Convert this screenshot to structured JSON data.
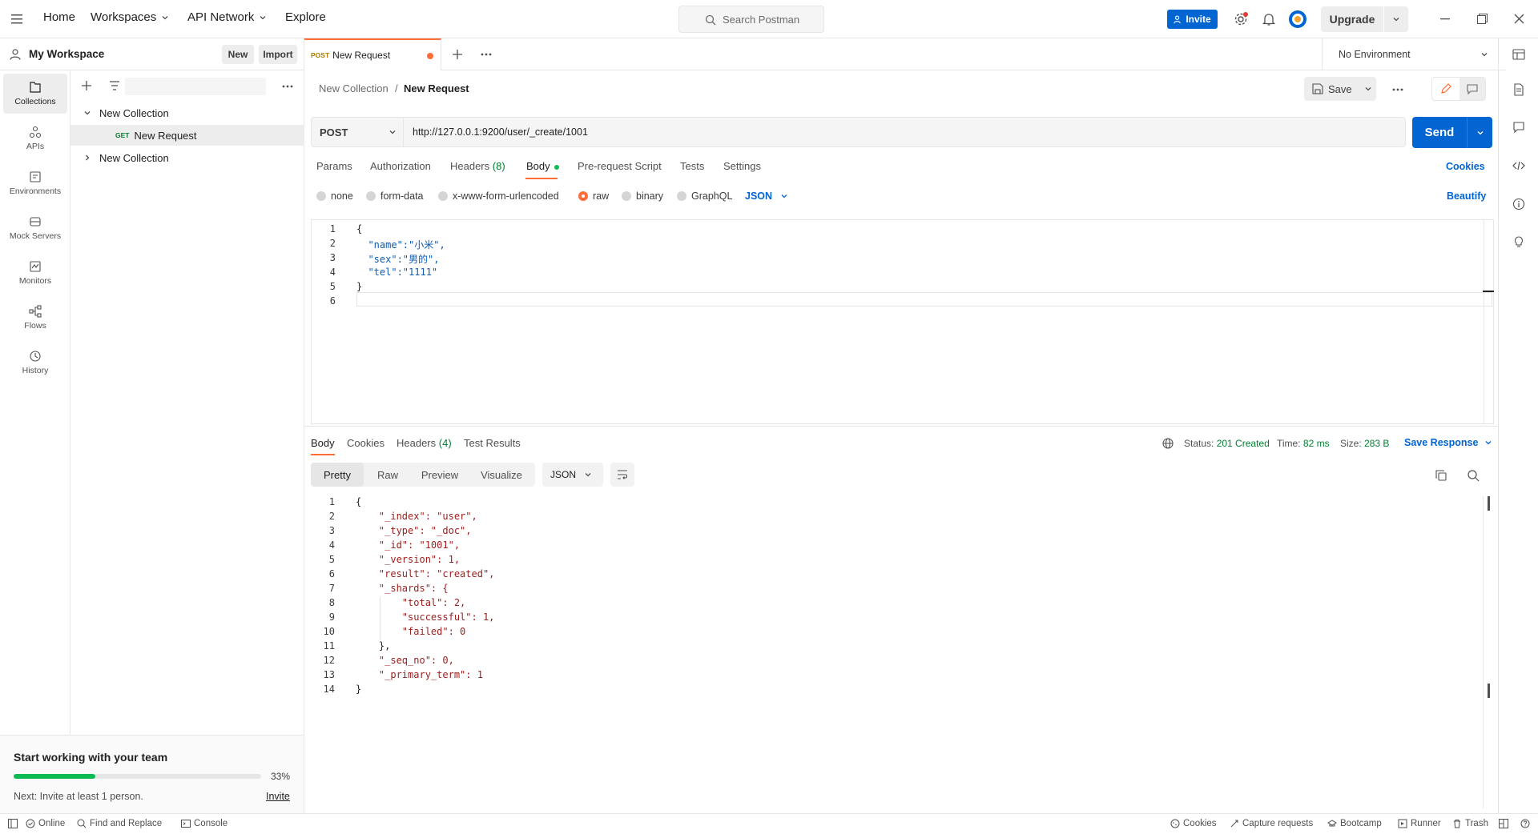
{
  "topbar": {
    "nav": [
      "Home",
      "Workspaces",
      "API Network",
      "Explore"
    ],
    "search_placeholder": "Search Postman",
    "invite_label": "Invite",
    "upgrade_label": "Upgrade"
  },
  "workspace": {
    "title": "My Workspace",
    "new_label": "New",
    "import_label": "Import"
  },
  "rail": [
    {
      "label": "Collections",
      "icon": "collections-icon"
    },
    {
      "label": "APIs",
      "icon": "apis-icon"
    },
    {
      "label": "Environments",
      "icon": "environments-icon"
    },
    {
      "label": "Mock Servers",
      "icon": "mock-servers-icon"
    },
    {
      "label": "Monitors",
      "icon": "monitors-icon"
    },
    {
      "label": "Flows",
      "icon": "flows-icon"
    },
    {
      "label": "History",
      "icon": "history-icon"
    }
  ],
  "tree": {
    "collection1": "New Collection",
    "request_method": "GET",
    "request_name": "New Request",
    "collection2": "New Collection"
  },
  "team_card": {
    "title": "Start working with your team",
    "progress_percent": 33,
    "progress_label": "33%",
    "next_text": "Next: Invite at least 1 person.",
    "invite_link": "Invite"
  },
  "tab": {
    "method": "POST",
    "name": "New Request"
  },
  "environment": "No Environment",
  "breadcrumb": {
    "collection": "New Collection",
    "separator": "/",
    "request": "New Request"
  },
  "save_label": "Save",
  "request": {
    "method": "POST",
    "url": "http://127.0.0.1:9200/user/_create/1001",
    "send_label": "Send",
    "tabs": {
      "params": "Params",
      "authorization": "Authorization",
      "headers": "Headers",
      "headers_count": "(8)",
      "body": "Body",
      "prerequest": "Pre-request Script",
      "tests": "Tests",
      "settings": "Settings"
    },
    "cookies_link": "Cookies",
    "body_types": [
      "none",
      "form-data",
      "x-www-form-urlencoded",
      "raw",
      "binary",
      "GraphQL"
    ],
    "body_format": "JSON",
    "beautify_link": "Beautify",
    "body_lines": [
      "{",
      "  \"name\":\"小米\",",
      "  \"sex\":\"男的\",",
      "  \"tel\":\"1111\"",
      "}",
      ""
    ]
  },
  "response": {
    "tabs": {
      "body": "Body",
      "cookies": "Cookies",
      "headers": "Headers",
      "headers_count": "(4)",
      "test_results": "Test Results"
    },
    "status_label": "Status:",
    "status_value": "201 Created",
    "time_label": "Time:",
    "time_value": "82 ms",
    "size_label": "Size:",
    "size_value": "283 B",
    "save_response": "Save Response",
    "views": [
      "Pretty",
      "Raw",
      "Preview",
      "Visualize"
    ],
    "format": "JSON",
    "lines": [
      "{",
      "    \"_index\": \"user\",",
      "    \"_type\": \"_doc\",",
      "    \"_id\": \"1001\",",
      "    \"_version\": 1,",
      "    \"result\": \"created\",",
      "    \"_shards\": {",
      "        \"total\": 2,",
      "        \"successful\": 1,",
      "        \"failed\": 0",
      "    },",
      "    \"_seq_no\": 0,",
      "    \"_primary_term\": 1",
      "}"
    ]
  },
  "statusbar": {
    "online": "Online",
    "find_replace": "Find and Replace",
    "console": "Console",
    "cookies": "Cookies",
    "capture": "Capture requests",
    "bootcamp": "Bootcamp",
    "runner": "Runner",
    "trash": "Trash"
  },
  "colors": {
    "accent": "#ff6c37",
    "primary": "#0265d2",
    "success": "#007f31"
  }
}
